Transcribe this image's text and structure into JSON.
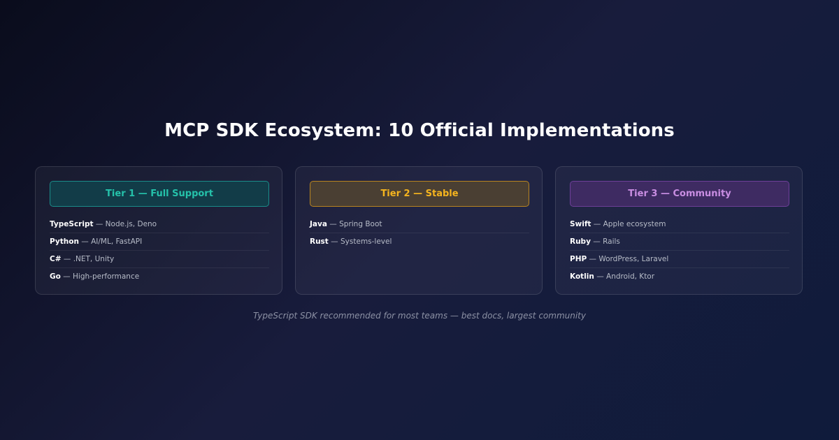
{
  "title": "MCP SDK Ecosystem: 10 Official Implementations",
  "tiers": [
    {
      "label": "Tier 1 — Full Support",
      "color": "#25c2aa",
      "sdks": [
        {
          "name": "TypeScript",
          "desc": " — Node.js, Deno"
        },
        {
          "name": "Python",
          "desc": " — AI/ML, FastAPI"
        },
        {
          "name": "C#",
          "desc": " — .NET, Unity"
        },
        {
          "name": "Go",
          "desc": " — High-performance"
        }
      ]
    },
    {
      "label": "Tier 2 — Stable",
      "color": "#f5b41e",
      "sdks": [
        {
          "name": "Java",
          "desc": " — Spring Boot"
        },
        {
          "name": "Rust",
          "desc": " — Systems-level"
        }
      ]
    },
    {
      "label": "Tier 3 — Community",
      "color": "#c98ee3",
      "sdks": [
        {
          "name": "Swift",
          "desc": " — Apple ecosystem"
        },
        {
          "name": "Ruby",
          "desc": " — Rails"
        },
        {
          "name": "PHP",
          "desc": " — WordPress, Laravel"
        },
        {
          "name": "Kotlin",
          "desc": " — Android, Ktor"
        }
      ]
    }
  ],
  "footnote": "TypeScript SDK recommended for most teams — best docs, largest community"
}
